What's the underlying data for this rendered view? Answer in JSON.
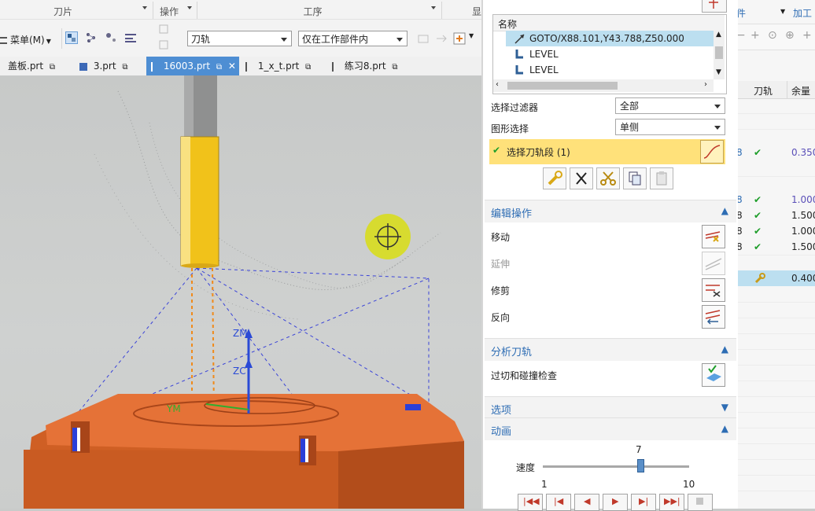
{
  "ribbon": {
    "groups": {
      "blade": "刀片",
      "operation": "操作",
      "procedure": "工序",
      "d": "显"
    },
    "menu_label": "菜单(M)",
    "dropdown1": "刀轨",
    "dropdown2": "仅在工作部件内"
  },
  "tabs": [
    {
      "label": "盖板.prt"
    },
    {
      "label": "3.prt"
    },
    {
      "label": "16003.prt"
    },
    {
      "label": "1_x_t.prt"
    },
    {
      "label": "练习8.prt"
    }
  ],
  "viewport": {
    "axis_zm": "ZM",
    "axis_zc": "ZC",
    "axis_ym": "YM"
  },
  "right_panel": {
    "menu_left": "件",
    "menu_right": "加工",
    "col_toolpath": "刀轨",
    "col_remaining": "余量",
    "rows": [
      {
        "prefix": "8",
        "check": "✔",
        "value": "0.350"
      },
      {
        "prefix": "8",
        "check": "✔",
        "value": "1.000"
      },
      {
        "prefix": "8",
        "check": "✔",
        "value": "1.500"
      },
      {
        "prefix": "8",
        "check": "✔",
        "value": "1.000"
      },
      {
        "prefix": "8",
        "check": "✔",
        "value": "1.500"
      },
      {
        "prefix": "",
        "check": "",
        "value": "0.400"
      }
    ]
  },
  "dialog": {
    "list_header": "名称",
    "list_items": [
      "GOTO/X88.101,Y43.788,Z50.000",
      "LEVEL",
      "LEVEL"
    ],
    "filter_label": "选择过滤器",
    "filter_value": "全部",
    "shape_label": "图形选择",
    "shape_value": "单侧",
    "select_segment": "选择刀轨段 (1)",
    "edit_section": "编辑操作",
    "move": "移动",
    "extend": "延伸",
    "trim": "修剪",
    "reverse": "反向",
    "analyze_section": "分析刀轨",
    "overcut_check": "过切和碰撞检查",
    "options_section": "选项",
    "animation_section": "动画",
    "speed_label": "速度",
    "speed_value": "7",
    "speed_min": "1",
    "speed_max": "10",
    "speed_fraction": 0.667
  },
  "colors": {
    "accent": "#2e6db4",
    "tab_active": "#4e8ed3",
    "selected_row": "#bcdff0",
    "highlight_yellow": "#ffe17a",
    "check_green": "#1e9e2a",
    "model_orange": "#dd6b2f",
    "tool_yellow": "#f1c21a"
  }
}
